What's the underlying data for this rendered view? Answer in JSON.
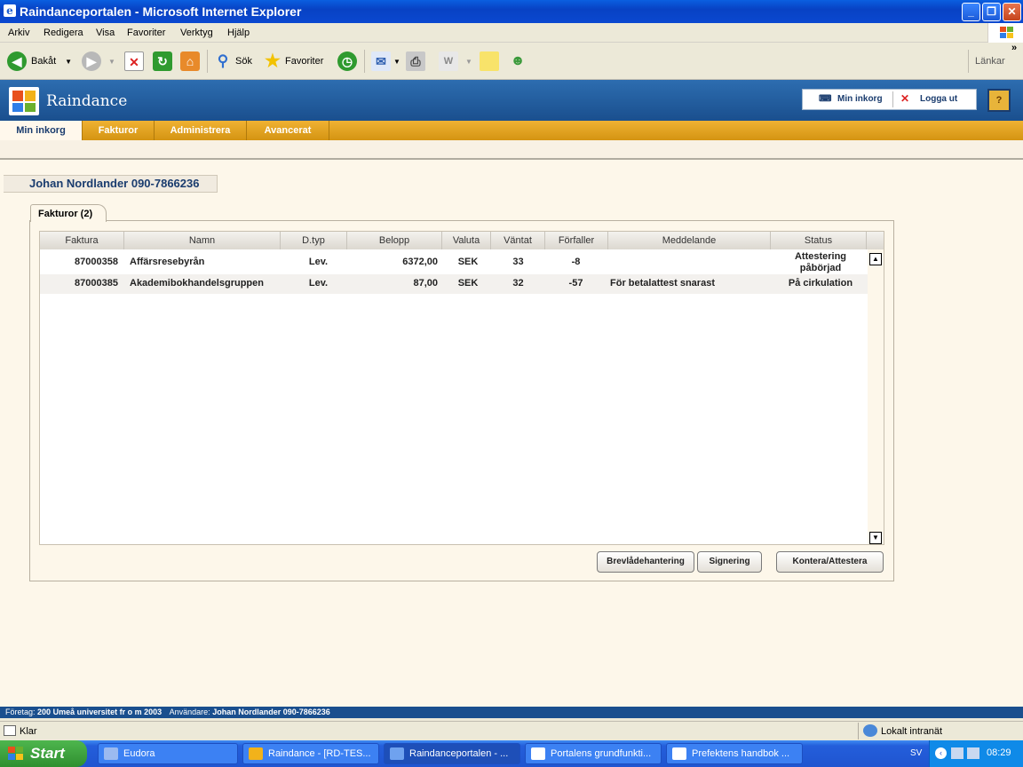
{
  "window": {
    "title": "Raindanceportalen - Microsoft Internet Explorer"
  },
  "menu": {
    "items": [
      "Arkiv",
      "Redigera",
      "Visa",
      "Favoriter",
      "Verktyg",
      "Hjälp"
    ]
  },
  "toolbar": {
    "back": "Bakåt",
    "search": "Sök",
    "favorites": "Favoriter",
    "links": "Länkar"
  },
  "app": {
    "name": "Raindance",
    "inbox_button": "Min inkorg",
    "logout_button": "Logga ut",
    "help": "?"
  },
  "tabs": [
    "Min inkorg",
    "Fakturor",
    "Administrera",
    "Avancerat"
  ],
  "user": {
    "name": "Johan Nordlander 090-7866236"
  },
  "panel": {
    "tab_label": "Fakturor (2)"
  },
  "table": {
    "columns": [
      "Faktura",
      "Namn",
      "D.typ",
      "Belopp",
      "Valuta",
      "Väntat",
      "Förfaller",
      "Meddelande",
      "Status"
    ],
    "rows": [
      {
        "faktura": "87000358",
        "namn": "Affärsresebyrån",
        "dtyp": "Lev.",
        "belopp": "6372,00",
        "valuta": "SEK",
        "vantat": "33",
        "forfaller": "-8",
        "meddelande": "",
        "status": "Attestering påbörjad"
      },
      {
        "faktura": "87000385",
        "namn": "Akademibokhandelsgruppen",
        "dtyp": "Lev.",
        "belopp": "87,00",
        "valuta": "SEK",
        "vantat": "32",
        "forfaller": "-57",
        "meddelande": "För betalattest snarast",
        "status": "På cirkulation"
      }
    ]
  },
  "buttons": {
    "mailbox": "Brevlådehantering",
    "signing": "Signering",
    "account": "Kontera/Attestera"
  },
  "footer": {
    "company_label": "Företag:",
    "company": "200 Umeå universitet fr o m 2003",
    "user_label": "Användare:",
    "user": "Johan Nordlander 090-7866236"
  },
  "statusbar": {
    "left": "Klar",
    "zone": "Lokalt intranät"
  },
  "taskbar": {
    "start": "Start",
    "items": [
      "Eudora",
      "Raindance - [RD-TES...",
      "Raindanceportalen - ...",
      "Portalens grundfunkti...",
      "Prefektens handbok ..."
    ],
    "lang": "SV",
    "time": "08:29"
  }
}
